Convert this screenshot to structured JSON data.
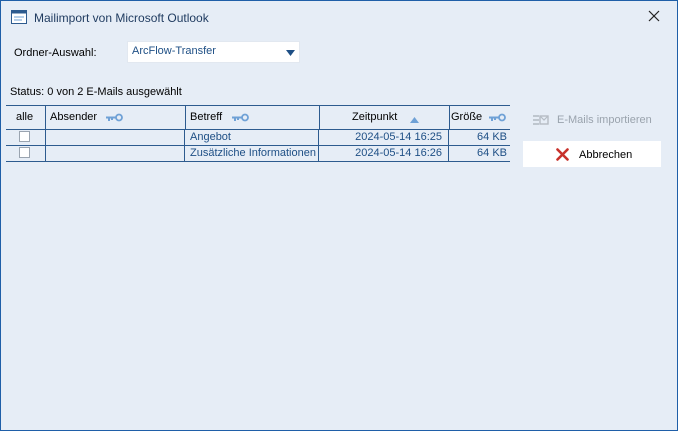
{
  "window": {
    "title": "Mailimport von Microsoft Outlook",
    "icons": {
      "app": "window-app-icon",
      "close": "close-icon"
    }
  },
  "folder": {
    "label": "Ordner-Auswahl:",
    "selected": "ArcFlow-Transfer",
    "icon": "chevron-down-icon"
  },
  "status": {
    "text": "Status: 0 von 2 E-Mails ausgewählt"
  },
  "table": {
    "columns": {
      "all": "alle",
      "sender": "Absender",
      "subject": "Betreff",
      "time": "Zeitpunkt",
      "size": "Größe"
    },
    "rows": [
      {
        "checked": false,
        "sender": "",
        "subject": "Angebot",
        "time": "2024-05-14 16:25",
        "size": "64 KB"
      },
      {
        "checked": false,
        "sender": "",
        "subject": "Zusätzliche Informationen",
        "time": "2024-05-14 16:26",
        "size": "64 KB"
      }
    ]
  },
  "buttons": {
    "import": {
      "label": "E-Mails importieren",
      "enabled": false,
      "icon": "import-mail-icon"
    },
    "cancel": {
      "label": "Abbrechen",
      "icon": "red-x-icon"
    }
  },
  "colors": {
    "background": "#e6edf6",
    "accent": "#2d5b8f",
    "text_blue": "#1e4f85",
    "cancel_red": "#c8312b",
    "filter_icon": "#6fa1d6"
  }
}
